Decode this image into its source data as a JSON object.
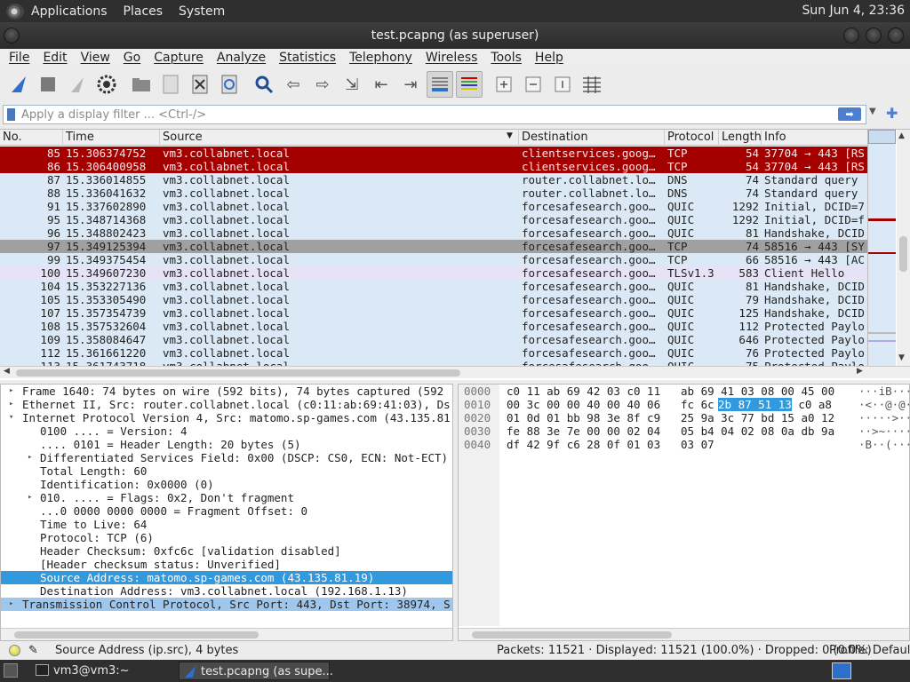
{
  "panel": {
    "menus": [
      "Applications",
      "Places",
      "System"
    ],
    "clock": "Sun Jun 4, 23:36"
  },
  "window": {
    "title": "test.pcapng (as superuser)"
  },
  "menubar": [
    "File",
    "Edit",
    "View",
    "Go",
    "Capture",
    "Analyze",
    "Statistics",
    "Telephony",
    "Wireless",
    "Tools",
    "Help"
  ],
  "toolbar": {
    "icons": [
      "shark-fin-icon",
      "stop-icon",
      "restart-icon",
      "options-gear-icon",
      "open-folder-icon",
      "save-icon",
      "close-file-icon",
      "reload-icon",
      "find-icon",
      "back-icon",
      "forward-icon",
      "goto-icon",
      "first-icon",
      "last-icon",
      "autoscroll-icon",
      "colorize-icon",
      "zoom-in-icon",
      "zoom-out-icon",
      "normal-size-icon",
      "resize-columns-icon"
    ]
  },
  "filter": {
    "placeholder": "Apply a display filter ... <Ctrl-/>"
  },
  "packet_list": {
    "columns": [
      "No.",
      "Time",
      "Source",
      "Destination",
      "Protocol",
      "Length",
      "Info"
    ],
    "rows": [
      {
        "no": "85",
        "time": "15.306374752",
        "src": "vm3.collabnet.local",
        "dst": "clientservices.goog…",
        "proto": "TCP",
        "len": "54",
        "info": "37704 → 443 [RS",
        "style": "tcp-bad"
      },
      {
        "no": "86",
        "time": "15.306400958",
        "src": "vm3.collabnet.local",
        "dst": "clientservices.goog…",
        "proto": "TCP",
        "len": "54",
        "info": "37704 → 443 [RS",
        "style": "tcp-bad"
      },
      {
        "no": "87",
        "time": "15.336014855",
        "src": "vm3.collabnet.local",
        "dst": "router.collabnet.lo…",
        "proto": "DNS",
        "len": "74",
        "info": "Standard query",
        "style": "blue"
      },
      {
        "no": "88",
        "time": "15.336041632",
        "src": "vm3.collabnet.local",
        "dst": "router.collabnet.lo…",
        "proto": "DNS",
        "len": "74",
        "info": "Standard query",
        "style": "blue"
      },
      {
        "no": "91",
        "time": "15.337602890",
        "src": "vm3.collabnet.local",
        "dst": "forcesafesearch.goo…",
        "proto": "QUIC",
        "len": "1292",
        "info": "Initial, DCID=7",
        "style": "blue"
      },
      {
        "no": "95",
        "time": "15.348714368",
        "src": "vm3.collabnet.local",
        "dst": "forcesafesearch.goo…",
        "proto": "QUIC",
        "len": "1292",
        "info": "Initial, DCID=f",
        "style": "blue"
      },
      {
        "no": "96",
        "time": "15.348802423",
        "src": "vm3.collabnet.local",
        "dst": "forcesafesearch.goo…",
        "proto": "QUIC",
        "len": "81",
        "info": "Handshake, DCID",
        "style": "blue"
      },
      {
        "no": "97",
        "time": "15.349125394",
        "src": "vm3.collabnet.local",
        "dst": "forcesafesearch.goo…",
        "proto": "TCP",
        "len": "74",
        "info": "58516 → 443 [SY",
        "style": "sel"
      },
      {
        "no": "99",
        "time": "15.349375454",
        "src": "vm3.collabnet.local",
        "dst": "forcesafesearch.goo…",
        "proto": "TCP",
        "len": "66",
        "info": "58516 → 443 [AC",
        "style": "blue"
      },
      {
        "no": "100",
        "time": "15.349607230",
        "src": "vm3.collabnet.local",
        "dst": "forcesafesearch.goo…",
        "proto": "TLSv1.3",
        "len": "583",
        "info": "Client Hello",
        "style": "lav"
      },
      {
        "no": "104",
        "time": "15.353227136",
        "src": "vm3.collabnet.local",
        "dst": "forcesafesearch.goo…",
        "proto": "QUIC",
        "len": "81",
        "info": "Handshake, DCID",
        "style": "blue"
      },
      {
        "no": "105",
        "time": "15.353305490",
        "src": "vm3.collabnet.local",
        "dst": "forcesafesearch.goo…",
        "proto": "QUIC",
        "len": "79",
        "info": "Handshake, DCID",
        "style": "blue"
      },
      {
        "no": "107",
        "time": "15.357354739",
        "src": "vm3.collabnet.local",
        "dst": "forcesafesearch.goo…",
        "proto": "QUIC",
        "len": "125",
        "info": "Handshake, DCID",
        "style": "blue"
      },
      {
        "no": "108",
        "time": "15.357532604",
        "src": "vm3.collabnet.local",
        "dst": "forcesafesearch.goo…",
        "proto": "QUIC",
        "len": "112",
        "info": "Protected Paylo",
        "style": "blue"
      },
      {
        "no": "109",
        "time": "15.358084647",
        "src": "vm3.collabnet.local",
        "dst": "forcesafesearch.goo…",
        "proto": "QUIC",
        "len": "646",
        "info": "Protected Paylo",
        "style": "blue"
      },
      {
        "no": "112",
        "time": "15.361661220",
        "src": "vm3.collabnet.local",
        "dst": "forcesafesearch.goo…",
        "proto": "QUIC",
        "len": "76",
        "info": "Protected Paylo",
        "style": "blue"
      },
      {
        "no": "113",
        "time": "15.361743718",
        "src": "vm3.collabnet.local",
        "dst": "forcesafesearch.goo…",
        "proto": "QUIC",
        "len": "75",
        "info": "Protected Paylo",
        "style": "blue"
      }
    ]
  },
  "details": [
    {
      "indent": 0,
      "arrow": "▸",
      "text": "Frame 1640: 74 bytes on wire (592 bits), 74 bytes captured (592",
      "style": ""
    },
    {
      "indent": 0,
      "arrow": "▸",
      "text": "Ethernet II, Src: router.collabnet.local (c0:11:ab:69:41:03), Ds",
      "style": ""
    },
    {
      "indent": 0,
      "arrow": "▾",
      "text": "Internet Protocol Version 4, Src: matomo.sp-games.com (43.135.81",
      "style": ""
    },
    {
      "indent": 1,
      "arrow": "",
      "text": "0100 .... = Version: 4",
      "style": ""
    },
    {
      "indent": 1,
      "arrow": "",
      "text": ".... 0101 = Header Length: 20 bytes (5)",
      "style": ""
    },
    {
      "indent": 1,
      "arrow": "▸",
      "text": "Differentiated Services Field: 0x00 (DSCP: CS0, ECN: Not-ECT)",
      "style": ""
    },
    {
      "indent": 1,
      "arrow": "",
      "text": "Total Length: 60",
      "style": ""
    },
    {
      "indent": 1,
      "arrow": "",
      "text": "Identification: 0x0000 (0)",
      "style": ""
    },
    {
      "indent": 1,
      "arrow": "▸",
      "text": "010. .... = Flags: 0x2, Don't fragment",
      "style": ""
    },
    {
      "indent": 1,
      "arrow": "",
      "text": "...0 0000 0000 0000 = Fragment Offset: 0",
      "style": ""
    },
    {
      "indent": 1,
      "arrow": "",
      "text": "Time to Live: 64",
      "style": ""
    },
    {
      "indent": 1,
      "arrow": "",
      "text": "Protocol: TCP (6)",
      "style": ""
    },
    {
      "indent": 1,
      "arrow": "",
      "text": "Header Checksum: 0xfc6c [validation disabled]",
      "style": ""
    },
    {
      "indent": 1,
      "arrow": "",
      "text": "[Header checksum status: Unverified]",
      "style": ""
    },
    {
      "indent": 1,
      "arrow": "",
      "text": "Source Address: matomo.sp-games.com (43.135.81.19)",
      "style": "sel"
    },
    {
      "indent": 1,
      "arrow": "",
      "text": "Destination Address: vm3.collabnet.local (192.168.1.13)",
      "style": ""
    },
    {
      "indent": 0,
      "arrow": "▸",
      "text": "Transmission Control Protocol, Src Port: 443, Dst Port: 38974, S",
      "style": "hl"
    }
  ],
  "bytes": [
    {
      "off": "0000",
      "hex1": "c0 11 ab 69 42 03 c0 11",
      "hex2": "ab 69 41 03 08 00 45 00",
      "asc": "···iB···"
    },
    {
      "off": "0010",
      "hex1": "00 3c 00 00 40 00 40 06",
      "hex2": "fc 6c ",
      "hl": "2b 87 51 13",
      "hex3": " c0 a8",
      "asc": "·<··@·@·"
    },
    {
      "off": "0020",
      "hex1": "01 0d 01 bb 98 3e 8f c9",
      "hex2": "25 9a 3c 77 bd 15 a0 12",
      "asc": "·····>··"
    },
    {
      "off": "0030",
      "hex1": "fe 88 3e 7e 00 00 02 04",
      "hex2": "05 b4 04 02 08 0a db 9a",
      "asc": "··>~····"
    },
    {
      "off": "0040",
      "hex1": "df 42 9f c6 28 0f 01 03",
      "hex2": "03 07",
      "asc": "·B··(···"
    }
  ],
  "status": {
    "field": "Source Address (ip.src), 4 bytes",
    "counts": "Packets: 11521 · Displayed: 11521 (100.0%) · Dropped: 0 (0.0%)",
    "profile": "Profile: Default"
  },
  "taskbar": {
    "tasks": [
      "vm3@vm3:~",
      "test.pcapng (as supe..."
    ]
  },
  "colors": {
    "tcp_bad_bg": "#a40000",
    "row_blue": "#dbe9f6",
    "selection": "#3399dd"
  }
}
